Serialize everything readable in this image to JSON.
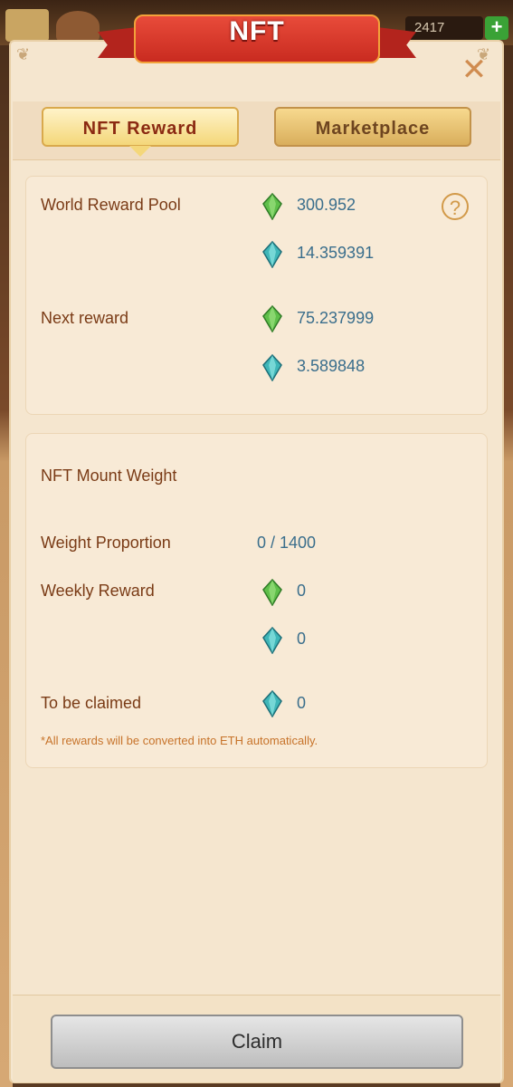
{
  "hud": {
    "resource_value": "2417",
    "plus_label": "+"
  },
  "title": "NFT",
  "close_label": "✕",
  "tabs": [
    {
      "label": "NFT Reward",
      "active": true
    },
    {
      "label": "Marketplace",
      "active": false
    }
  ],
  "pool": {
    "world_reward_pool_label": "World Reward Pool",
    "world_green": "300.952",
    "world_blue": "14.359391",
    "next_reward_label": "Next reward",
    "next_green": "75.237999",
    "next_blue": "3.589848",
    "help_label": "?"
  },
  "mount": {
    "title": "NFT Mount Weight",
    "weight_proportion_label": "Weight Proportion",
    "weight_proportion_value": "0 / 1400",
    "weekly_reward_label": "Weekly Reward",
    "weekly_green": "0",
    "weekly_blue": "0",
    "to_be_claimed_label": "To be claimed",
    "to_be_claimed_value": "0",
    "note": "*All rewards will be converted into ETH automatically."
  },
  "claim_label": "Claim",
  "colors": {
    "green_gem": "#5fbf4a",
    "blue_gem": "#3fb6b8",
    "accent": "#c92b20"
  }
}
